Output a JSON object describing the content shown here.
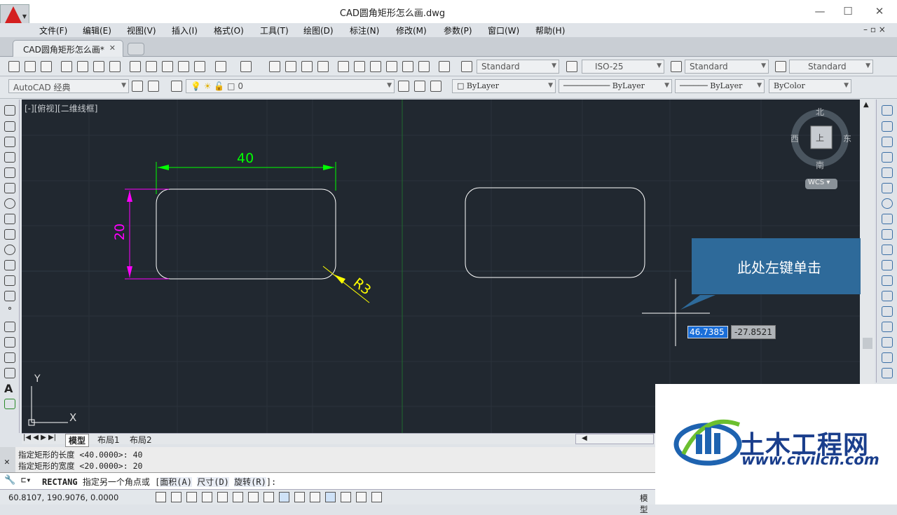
{
  "window": {
    "title": "CAD圆角矩形怎么画.dwg",
    "controls": [
      "—",
      "☐",
      "✕"
    ]
  },
  "menu": [
    "文件(F)",
    "编辑(E)",
    "视图(V)",
    "插入(I)",
    "格式(O)",
    "工具(T)",
    "绘图(D)",
    "标注(N)",
    "修改(M)",
    "参数(P)",
    "窗口(W)",
    "帮助(H)"
  ],
  "tab": {
    "label": "CAD圆角矩形怎么画*",
    "close": "✕"
  },
  "styles": {
    "text_style": "Standard",
    "dim_style": "ISO-25",
    "table_style": "Standard",
    "mleader_style": "Standard"
  },
  "workspace": "AutoCAD 经典",
  "layer": {
    "current": "0"
  },
  "properties": {
    "color": "ByLayer",
    "linetype": "ByLayer",
    "lineweight": "ByLayer",
    "plotstyle": "ByColor"
  },
  "viewport": {
    "label": "[-][俯视][二维线框]",
    "ucs_x": "X",
    "ucs_y": "Y"
  },
  "viewcube": {
    "north": "北",
    "south": "南",
    "east": "东",
    "west": "西",
    "top": "上",
    "wcs": "WCS"
  },
  "drawing": {
    "dim_width": "40",
    "dim_height": "20",
    "radius": "R3",
    "input_x": "46.7385",
    "input_y": "-27.8521"
  },
  "callout": {
    "text": "此处左键单击"
  },
  "layout_tabs": [
    "模型",
    "布局1",
    "布局2"
  ],
  "command": {
    "history": [
      "指定矩形的长度 <40.0000>: 40",
      "指定矩形的宽度 <20.0000>: 20"
    ],
    "prompt_cmd": "RECTANG",
    "prompt_text": "指定另一个角点或",
    "opt_area": "面积(A)",
    "opt_dim": "尺寸(D)",
    "opt_rot": "旋转(R)",
    "prompt_end": "]:"
  },
  "status": {
    "coords": "60.8107,  190.9076, 0.0000",
    "model": "模型"
  },
  "watermark": {
    "brand": "土木工程网",
    "url": "www.civilcn.com"
  },
  "colors": {
    "canvas": "#212830",
    "dim_green": "#00ff00",
    "dim_magenta": "#ff00ff",
    "dim_yellow": "#ffff00",
    "callout": "#2e6a9a",
    "logo_red": "#d42020"
  }
}
